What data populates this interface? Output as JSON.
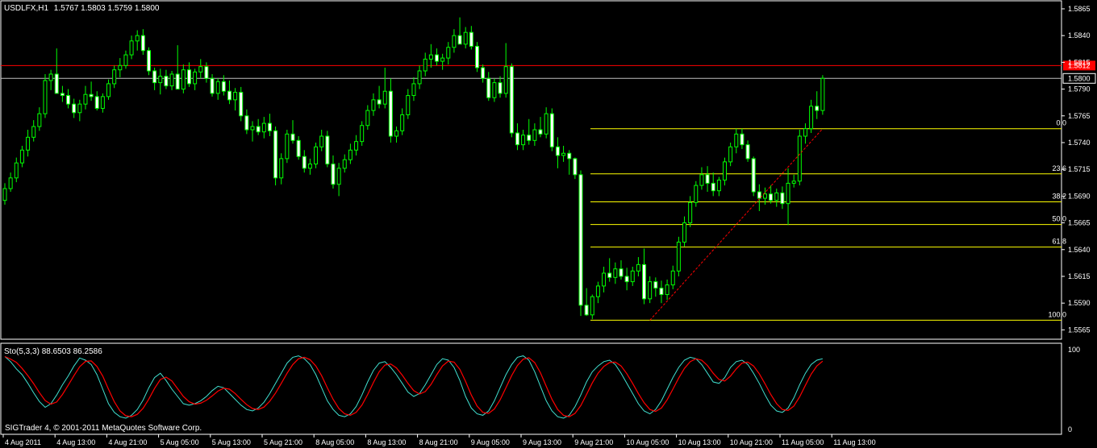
{
  "header": {
    "symbol": "USDLFX,H1",
    "ohlc": "1.5767 1.5803 1.5759 1.5800"
  },
  "indicator": {
    "label": "Sto(5,3,3) 88.6503 86.2586",
    "max_label": "100",
    "min_label": "0"
  },
  "copyright": "SIGTrader 4, © 2001-2011 MetaQuotes Software Corp.",
  "colors": {
    "background": "#000000",
    "frame": "#ffffff",
    "bull_body": "#000000",
    "bear_body": "#ffffff",
    "wick": "#00ff00",
    "fib": "#ffff00",
    "fib_label": "#ffff00",
    "trend": "#ff0000",
    "bid_line": "#ff0000",
    "ask_line": "#c0c0c0",
    "stoch_main": "#40e0d0",
    "stoch_signal": "#ff0000",
    "price_badge_red": "#ff0000"
  },
  "chart_data": {
    "type": "candlestick",
    "price_axis": {
      "ticks": [
        "1.5865",
        "1.5840",
        "1.5815",
        "1.5790",
        "1.5765",
        "1.5740",
        "1.5715",
        "1.5690",
        "1.5665",
        "1.5640",
        "1.5615",
        "1.5590",
        "1.5565"
      ],
      "ylim": [
        1.5557,
        1.5871
      ]
    },
    "time_axis": {
      "ticks": [
        "4 Aug 2011",
        "4 Aug 13:00",
        "4 Aug 21:00",
        "5 Aug 05:00",
        "5 Aug 13:00",
        "5 Aug 21:00",
        "8 Aug 05:00",
        "8 Aug 13:00",
        "8 Aug 21:00",
        "9 Aug 05:00",
        "9 Aug 13:00",
        "9 Aug 21:00",
        "10 Aug 05:00",
        "10 Aug 13:00",
        "10 Aug 21:00",
        "11 Aug 05:00",
        "11 Aug 13:00"
      ]
    },
    "horizontal_lines": {
      "bid": {
        "price": 1.5812,
        "label": "1.5812"
      },
      "ask": {
        "price": 1.58,
        "label": "1.5800"
      }
    },
    "fibonacci": {
      "high": 1.5753,
      "low": 1.5574,
      "levels": [
        {
          "label": "0.0",
          "ratio": 0.0
        },
        {
          "label": "23.6",
          "ratio": 0.236
        },
        {
          "label": "38.2",
          "ratio": 0.382
        },
        {
          "label": "50.0",
          "ratio": 0.5
        },
        {
          "label": "61.8",
          "ratio": 0.618
        },
        {
          "label": "100.0",
          "ratio": 1.0
        }
      ]
    },
    "trendline": {
      "from_index": 112,
      "to_index": 142,
      "from_price": 1.5574,
      "to_price": 1.5753
    },
    "candles": [
      [
        1.5686,
        1.5702,
        1.5682,
        1.5697
      ],
      [
        1.5697,
        1.5712,
        1.5694,
        1.5707
      ],
      [
        1.5707,
        1.5726,
        1.5703,
        1.5721
      ],
      [
        1.5721,
        1.5737,
        1.5717,
        1.5733
      ],
      [
        1.5733,
        1.5752,
        1.5727,
        1.5745
      ],
      [
        1.5745,
        1.5761,
        1.5741,
        1.5755
      ],
      [
        1.5755,
        1.5773,
        1.5751,
        1.5767
      ],
      [
        1.5767,
        1.5804,
        1.5763,
        1.5798
      ],
      [
        1.5798,
        1.5808,
        1.5789,
        1.5804
      ],
      [
        1.5804,
        1.5828,
        1.5795,
        1.5786
      ],
      [
        1.5786,
        1.5793,
        1.5778,
        1.5784
      ],
      [
        1.5784,
        1.579,
        1.5772,
        1.5776
      ],
      [
        1.5776,
        1.5781,
        1.5763,
        1.5768
      ],
      [
        1.5768,
        1.578,
        1.576,
        1.5776
      ],
      [
        1.5776,
        1.5793,
        1.5771,
        1.5785
      ],
      [
        1.5785,
        1.5797,
        1.5779,
        1.5783
      ],
      [
        1.5783,
        1.5788,
        1.577,
        1.5772
      ],
      [
        1.5772,
        1.5786,
        1.5768,
        1.5783
      ],
      [
        1.5783,
        1.5799,
        1.578,
        1.5795
      ],
      [
        1.5795,
        1.5812,
        1.5791,
        1.5808
      ],
      [
        1.5808,
        1.5819,
        1.5801,
        1.5812
      ],
      [
        1.5812,
        1.5826,
        1.5809,
        1.5822
      ],
      [
        1.5822,
        1.584,
        1.5818,
        1.5835
      ],
      [
        1.5835,
        1.5845,
        1.5826,
        1.584
      ],
      [
        1.584,
        1.5846,
        1.5822,
        1.5826
      ],
      [
        1.5826,
        1.5829,
        1.5803,
        1.5807
      ],
      [
        1.5807,
        1.581,
        1.5789,
        1.5796
      ],
      [
        1.5796,
        1.5809,
        1.5785,
        1.5802
      ],
      [
        1.5802,
        1.5808,
        1.579,
        1.5793
      ],
      [
        1.5793,
        1.5807,
        1.5789,
        1.5804
      ],
      [
        1.5804,
        1.5831,
        1.5799,
        1.579
      ],
      [
        1.579,
        1.5813,
        1.5786,
        1.5808
      ],
      [
        1.5808,
        1.5815,
        1.5792,
        1.5795
      ],
      [
        1.5795,
        1.5809,
        1.5789,
        1.5806
      ],
      [
        1.5806,
        1.5818,
        1.58,
        1.5811
      ],
      [
        1.5811,
        1.5815,
        1.5796,
        1.58
      ],
      [
        1.58,
        1.5804,
        1.5783,
        1.5786
      ],
      [
        1.5786,
        1.58,
        1.578,
        1.5797
      ],
      [
        1.5797,
        1.5803,
        1.5784,
        1.5788
      ],
      [
        1.5788,
        1.5798,
        1.5776,
        1.578
      ],
      [
        1.578,
        1.5791,
        1.577,
        1.5787
      ],
      [
        1.5787,
        1.5792,
        1.576,
        1.5765
      ],
      [
        1.5765,
        1.5771,
        1.5748,
        1.5752
      ],
      [
        1.5752,
        1.576,
        1.5741,
        1.5755
      ],
      [
        1.5755,
        1.5762,
        1.5747,
        1.575
      ],
      [
        1.575,
        1.5764,
        1.5744,
        1.5758
      ],
      [
        1.5758,
        1.5767,
        1.5746,
        1.5751
      ],
      [
        1.5751,
        1.5755,
        1.57,
        1.5707
      ],
      [
        1.5707,
        1.573,
        1.5701,
        1.5725
      ],
      [
        1.5725,
        1.5752,
        1.5721,
        1.5748
      ],
      [
        1.5748,
        1.5761,
        1.5739,
        1.5742
      ],
      [
        1.5742,
        1.5746,
        1.5724,
        1.5727
      ],
      [
        1.5727,
        1.5733,
        1.5712,
        1.5716
      ],
      [
        1.5716,
        1.5725,
        1.571,
        1.572
      ],
      [
        1.572,
        1.574,
        1.5716,
        1.5736
      ],
      [
        1.5736,
        1.5752,
        1.5732,
        1.5746
      ],
      [
        1.5746,
        1.5751,
        1.5717,
        1.572
      ],
      [
        1.572,
        1.5728,
        1.5697,
        1.5701
      ],
      [
        1.5701,
        1.5721,
        1.569,
        1.5716
      ],
      [
        1.5716,
        1.5729,
        1.5712,
        1.5724
      ],
      [
        1.5724,
        1.5739,
        1.572,
        1.5733
      ],
      [
        1.5733,
        1.5747,
        1.5728,
        1.5741
      ],
      [
        1.5741,
        1.576,
        1.5737,
        1.5756
      ],
      [
        1.5756,
        1.5775,
        1.5752,
        1.577
      ],
      [
        1.577,
        1.5786,
        1.5765,
        1.578
      ],
      [
        1.578,
        1.5793,
        1.5772,
        1.5776
      ],
      [
        1.5776,
        1.581,
        1.5772,
        1.5788
      ],
      [
        1.5788,
        1.58,
        1.574,
        1.5746
      ],
      [
        1.5746,
        1.5755,
        1.574,
        1.5751
      ],
      [
        1.5751,
        1.5772,
        1.5747,
        1.5766
      ],
      [
        1.5766,
        1.579,
        1.5762,
        1.5784
      ],
      [
        1.5784,
        1.5801,
        1.5779,
        1.5795
      ],
      [
        1.5795,
        1.5812,
        1.579,
        1.5807
      ],
      [
        1.5807,
        1.5824,
        1.5802,
        1.5818
      ],
      [
        1.5818,
        1.5832,
        1.581,
        1.5822
      ],
      [
        1.5822,
        1.5828,
        1.5812,
        1.5816
      ],
      [
        1.5816,
        1.5823,
        1.5808,
        1.5819
      ],
      [
        1.5819,
        1.5834,
        1.5813,
        1.5829
      ],
      [
        1.5829,
        1.5846,
        1.5824,
        1.584
      ],
      [
        1.584,
        1.5857,
        1.5832,
        1.5832
      ],
      [
        1.5832,
        1.5848,
        1.5828,
        1.5843
      ],
      [
        1.5843,
        1.5849,
        1.5827,
        1.583
      ],
      [
        1.583,
        1.5834,
        1.5806,
        1.581
      ],
      [
        1.581,
        1.5813,
        1.5796,
        1.58
      ],
      [
        1.58,
        1.5806,
        1.5779,
        1.5782
      ],
      [
        1.5782,
        1.58,
        1.5778,
        1.5796
      ],
      [
        1.5796,
        1.5802,
        1.5782,
        1.5786
      ],
      [
        1.5786,
        1.5833,
        1.5782,
        1.5811
      ],
      [
        1.5811,
        1.5814,
        1.5745,
        1.5749
      ],
      [
        1.5749,
        1.5758,
        1.5733,
        1.5738
      ],
      [
        1.5738,
        1.5752,
        1.5733,
        1.5747
      ],
      [
        1.5747,
        1.5762,
        1.5738,
        1.5742
      ],
      [
        1.5742,
        1.5758,
        1.5737,
        1.5752
      ],
      [
        1.5752,
        1.5764,
        1.5745,
        1.5748
      ],
      [
        1.5748,
        1.5773,
        1.5744,
        1.5767
      ],
      [
        1.5767,
        1.5772,
        1.5732,
        1.5736
      ],
      [
        1.5736,
        1.5745,
        1.5716,
        1.5728
      ],
      [
        1.5728,
        1.5737,
        1.5722,
        1.573
      ],
      [
        1.573,
        1.5733,
        1.571,
        1.5725
      ],
      [
        1.5725,
        1.5726,
        1.5706,
        1.571
      ],
      [
        1.571,
        1.5714,
        1.5578,
        1.5588
      ],
      [
        1.5588,
        1.5604,
        1.5578,
        1.5579
      ],
      [
        1.5579,
        1.5598,
        1.5575,
        1.5596
      ],
      [
        1.5596,
        1.561,
        1.559,
        1.5606
      ],
      [
        1.5606,
        1.5624,
        1.56,
        1.5618
      ],
      [
        1.5618,
        1.5632,
        1.561,
        1.5614
      ],
      [
        1.5614,
        1.5628,
        1.5608,
        1.5622
      ],
      [
        1.5622,
        1.563,
        1.5612,
        1.5615
      ],
      [
        1.5615,
        1.5623,
        1.5602,
        1.561
      ],
      [
        1.561,
        1.5624,
        1.5606,
        1.562
      ],
      [
        1.562,
        1.5633,
        1.5615,
        1.5626
      ],
      [
        1.5626,
        1.5641,
        1.5589,
        1.5594
      ],
      [
        1.5594,
        1.5615,
        1.559,
        1.561
      ],
      [
        1.561,
        1.5614,
        1.5596,
        1.5604
      ],
      [
        1.5604,
        1.5611,
        1.559,
        1.5598
      ],
      [
        1.5598,
        1.5612,
        1.5593,
        1.5607
      ],
      [
        1.5607,
        1.5625,
        1.5603,
        1.562
      ],
      [
        1.562,
        1.5652,
        1.5615,
        1.5647
      ],
      [
        1.5647,
        1.5671,
        1.5643,
        1.5665
      ],
      [
        1.5665,
        1.569,
        1.5661,
        1.5684
      ],
      [
        1.5684,
        1.5704,
        1.568,
        1.57
      ],
      [
        1.57,
        1.5717,
        1.5696,
        1.571
      ],
      [
        1.571,
        1.5718,
        1.5694,
        1.5702
      ],
      [
        1.5702,
        1.5712,
        1.569,
        1.5695
      ],
      [
        1.5695,
        1.5708,
        1.569,
        1.5705
      ],
      [
        1.5705,
        1.5726,
        1.57,
        1.5722
      ],
      [
        1.5722,
        1.574,
        1.5718,
        1.5736
      ],
      [
        1.5736,
        1.5753,
        1.573,
        1.5748
      ],
      [
        1.5748,
        1.5753,
        1.5734,
        1.5738
      ],
      [
        1.5738,
        1.5742,
        1.5722,
        1.5725
      ],
      [
        1.5725,
        1.5727,
        1.569,
        1.5694
      ],
      [
        1.5694,
        1.5701,
        1.5676,
        1.5688
      ],
      [
        1.5688,
        1.5698,
        1.5682,
        1.5692
      ],
      [
        1.5692,
        1.57,
        1.5683,
        1.5686
      ],
      [
        1.5686,
        1.5697,
        1.568,
        1.5693
      ],
      [
        1.5693,
        1.5699,
        1.5678,
        1.5683
      ],
      [
        1.5683,
        1.5716,
        1.5663,
        1.5702
      ],
      [
        1.5702,
        1.571,
        1.5698,
        1.5704
      ],
      [
        1.5704,
        1.5752,
        1.57,
        1.5746
      ],
      [
        1.5746,
        1.5758,
        1.5739,
        1.5753
      ],
      [
        1.5753,
        1.578,
        1.5749,
        1.5774
      ],
      [
        1.5774,
        1.5788,
        1.5762,
        1.577
      ],
      [
        1.577,
        1.5803,
        1.5766,
        1.58
      ]
    ],
    "stochastic": {
      "range": [
        0,
        100
      ],
      "main": [
        95,
        88,
        78,
        70,
        58,
        45,
        33,
        25,
        30,
        42,
        56,
        68,
        82,
        93,
        90,
        84,
        70,
        50,
        30,
        18,
        12,
        10,
        14,
        22,
        35,
        52,
        66,
        72,
        62,
        50,
        40,
        30,
        28,
        30,
        34,
        40,
        48,
        54,
        52,
        44,
        36,
        28,
        22,
        20,
        24,
        32,
        44,
        58,
        72,
        86,
        94,
        96,
        92,
        84,
        70,
        52,
        34,
        22,
        14,
        12,
        16,
        26,
        42,
        60,
        76,
        86,
        88,
        80,
        70,
        58,
        46,
        40,
        44,
        56,
        70,
        84,
        92,
        90,
        80,
        62,
        40,
        24,
        16,
        14,
        20,
        34,
        52,
        70,
        84,
        94,
        96,
        90,
        74,
        54,
        34,
        20,
        12,
        10,
        14,
        26,
        42,
        60,
        74,
        82,
        88,
        90,
        84,
        72,
        58,
        44,
        30,
        20,
        16,
        22,
        34,
        50,
        66,
        80,
        90,
        94,
        92,
        84,
        72,
        60,
        58,
        66,
        80,
        88,
        90,
        84,
        72,
        58,
        42,
        28,
        20,
        18,
        24,
        38,
        56,
        72,
        84,
        90,
        92
      ]
    }
  }
}
